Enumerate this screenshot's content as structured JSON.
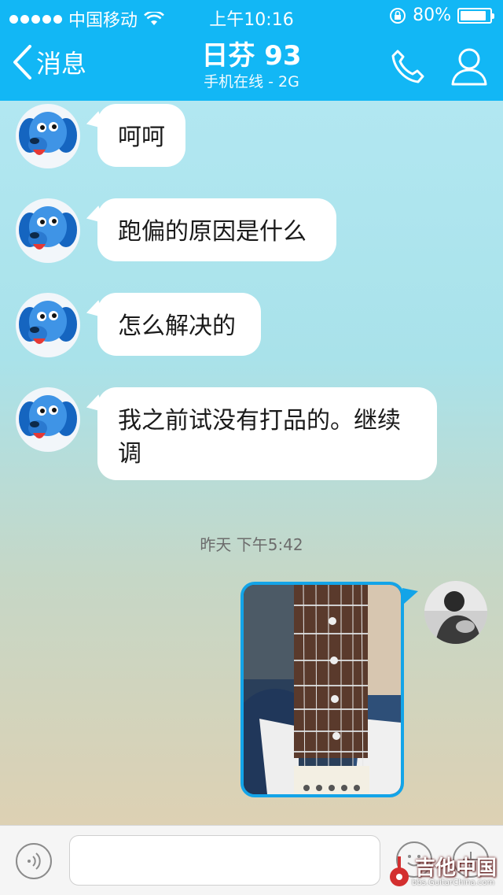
{
  "status_bar": {
    "carrier": "中国移动",
    "time": "上午10:16",
    "battery": "80%"
  },
  "nav": {
    "back_label": "消息",
    "title": "日芬 93",
    "subtitle": "手机在线 - 2G"
  },
  "messages": [
    {
      "sender": "other",
      "text": "呵呵"
    },
    {
      "sender": "other",
      "text": "跑偏的原因是什么"
    },
    {
      "sender": "other",
      "text": "怎么解决的"
    },
    {
      "sender": "other",
      "text": "我之前试没有打品的。继续调"
    }
  ],
  "timestamp": "昨天  下午5:42",
  "image_message": {
    "sender": "me",
    "content": "guitar-fretboard-photo"
  },
  "input": {
    "placeholder": ""
  },
  "watermark": {
    "text": "吉他中国",
    "url": "bbs.GuitarChina.com"
  },
  "colors": {
    "header": "#12b7f5",
    "bubble": "#ffffff",
    "image_border": "#13a4e8"
  }
}
